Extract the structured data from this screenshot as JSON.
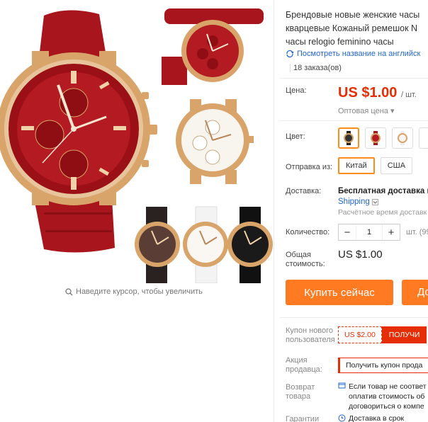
{
  "gallery": {
    "zoom_hint": "Наведите курсор, чтобы увеличить"
  },
  "product": {
    "title_lines": [
      "Брендовые новые женские часы",
      "кварцевые Кожаный ремешок N",
      "часы relogio feminino часы"
    ],
    "translate_link": "Посмотреть название на английск",
    "orders": "18 заказа(ов)"
  },
  "price": {
    "label": "Цена:",
    "value": "US $1.00",
    "unit": "/ шт.",
    "wholesale": "Оптовая цена ▾"
  },
  "color": {
    "label": "Цвет:",
    "options": [
      "black",
      "red",
      "white",
      "brown"
    ],
    "selected_index": 0
  },
  "ship_from": {
    "label": "Отправка из:",
    "options": [
      "Китай",
      "США"
    ],
    "selected": "Китай"
  },
  "delivery": {
    "label": "Доставка:",
    "line1": "Бесплатная доставка в I",
    "line2": "Shipping",
    "estimate": "Расчётное время доставк"
  },
  "quantity": {
    "label": "Количество:",
    "value": "1",
    "minus": "−",
    "plus": "+",
    "unit": "шт. (99"
  },
  "total": {
    "label_line1": "Общая",
    "label_line2": "стоимость:",
    "value": "US $1.00"
  },
  "actions": {
    "buy_now": "Купить сейчас",
    "add_to_cart": "До"
  },
  "coupon": {
    "label_lines": [
      "Купон нового",
      "пользователя"
    ],
    "amount": "US $2.00",
    "get": "ПОЛУЧИ"
  },
  "seller_promo": {
    "label_lines": [
      "Акция",
      "продавца:"
    ],
    "text": "Получить купон прода"
  },
  "returns": {
    "label_lines": [
      "Возврат",
      "товара"
    ],
    "lines": [
      "Если товар не соответ",
      "оплатив стоимость об",
      "договориться о компе"
    ]
  },
  "guarantee": {
    "label": "Гарантии",
    "text": "Доставка в срок"
  },
  "colors": {
    "accent": "#ff7a21",
    "price_red": "#e62e04",
    "link_blue": "#2266cc",
    "watch_red": "#a8151c",
    "gold": "#d9a46a"
  }
}
